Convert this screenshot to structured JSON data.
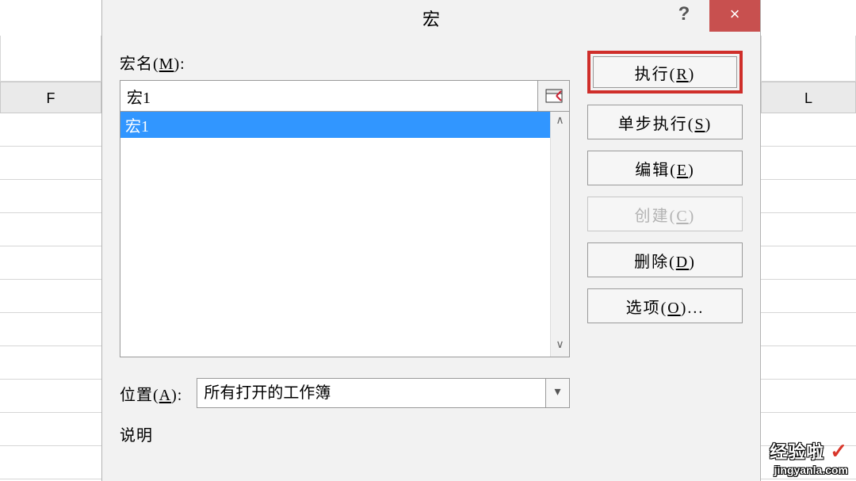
{
  "columns": {
    "left": "F",
    "right": "L"
  },
  "dialog": {
    "title": "宏",
    "help": "?",
    "close": "×",
    "name_label_prefix": "宏名(",
    "name_label_key": "M",
    "name_label_suffix": "):",
    "name_value": "宏1",
    "list": [
      {
        "label": "宏1",
        "selected": true
      }
    ],
    "location_label_prefix": "位置(",
    "location_label_key": "A",
    "location_label_suffix": "):",
    "location_value": "所有打开的工作簿",
    "description_label": "说明"
  },
  "buttons": {
    "run_prefix": "执行(",
    "run_key": "R",
    "run_suffix": ")",
    "step_prefix": "单步执行(",
    "step_key": "S",
    "step_suffix": ")",
    "edit_prefix": "编辑(",
    "edit_key": "E",
    "edit_suffix": ")",
    "create_prefix": "创建(",
    "create_key": "C",
    "create_suffix": ")",
    "delete_prefix": "删除(",
    "delete_key": "D",
    "delete_suffix": ")",
    "options_prefix": "选项(",
    "options_key": "O",
    "options_suffix": ")..."
  },
  "watermark": {
    "brand": "经验啦",
    "check": "✓",
    "url": "jingyanla.com"
  }
}
